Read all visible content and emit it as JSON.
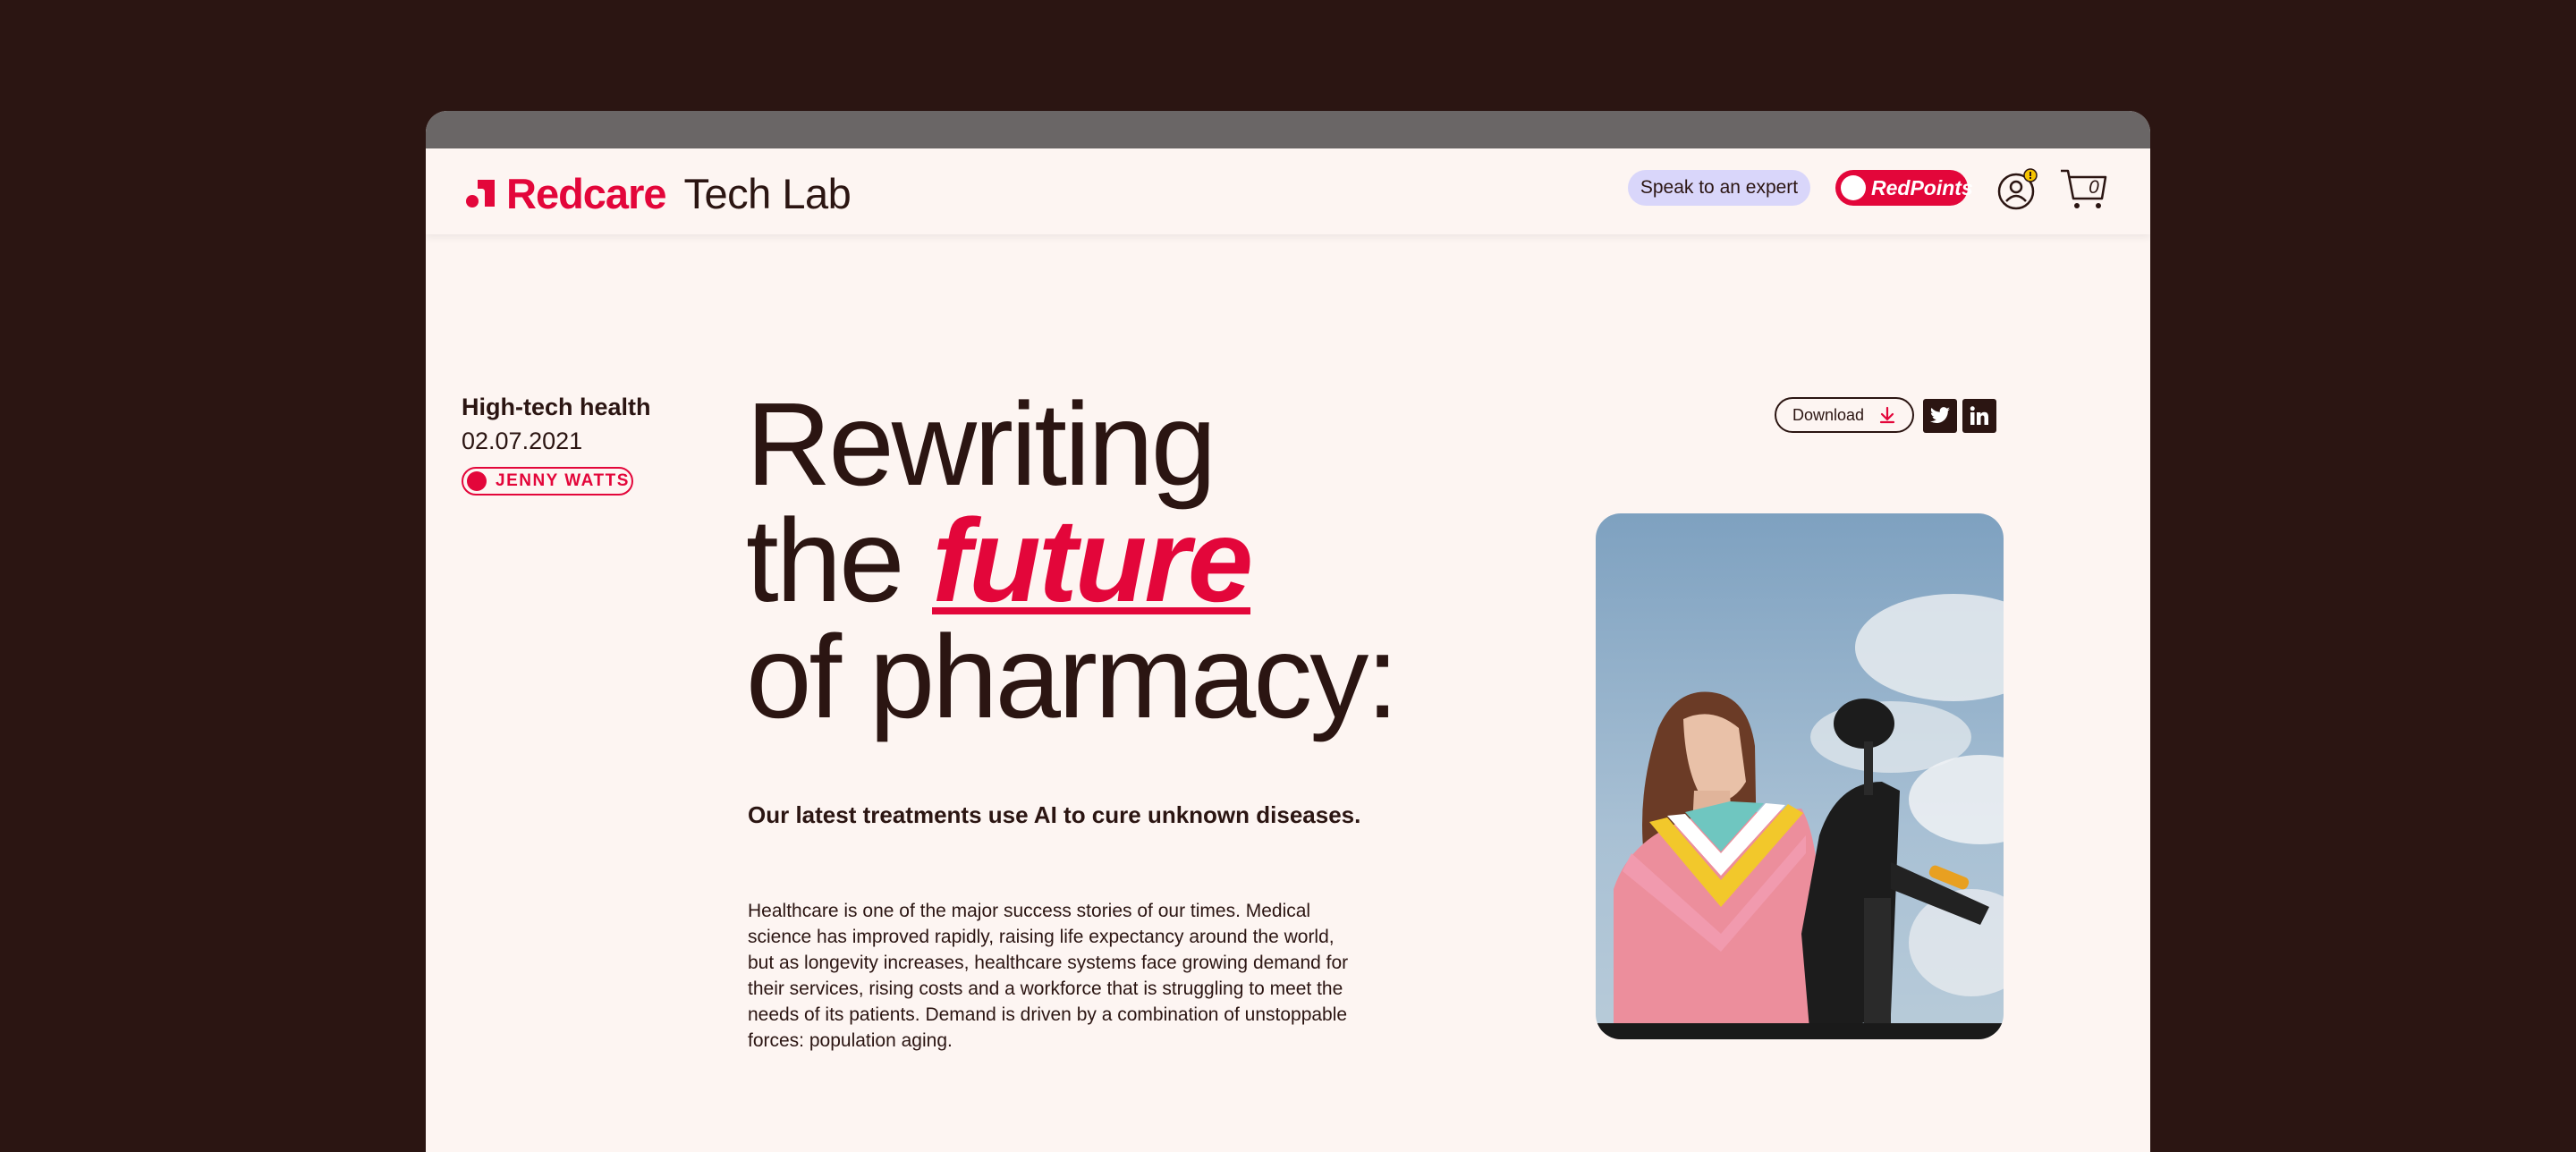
{
  "header": {
    "brand": "Redcare",
    "sub_brand": "Tech Lab",
    "expert_label": "Speak to an expert",
    "redpoints_label": "RedPoints",
    "cart_count": "0"
  },
  "article": {
    "category": "High-tech health",
    "date": "02.07.2021",
    "author": "JENNY WATTS",
    "headline_line1": "Rewriting",
    "headline_line2_prefix": "the",
    "headline_accent": "future",
    "headline_line3": "of pharmacy:",
    "subhead": "Our latest treatments use AI to cure unknown diseases.",
    "body": "Healthcare is one of the major success stories of our times. Medical science has improved rapidly, raising life expectancy around the world, but as longevity increases, healthcare systems face growing demand for their services, rising costs and a workforce that is struggling to meet the needs of its patients. Demand is driven by a combination of unstoppable forces: population aging."
  },
  "actions": {
    "download_label": "Download",
    "twitter_icon": "twitter-icon",
    "linkedin_icon": "linkedin-icon"
  },
  "colors": {
    "accent": "#e3063a",
    "text": "#2b1512",
    "page_bg": "#fdf5f2",
    "outer_bg": "#2b1512",
    "expert_bg": "#d9d6fa"
  }
}
